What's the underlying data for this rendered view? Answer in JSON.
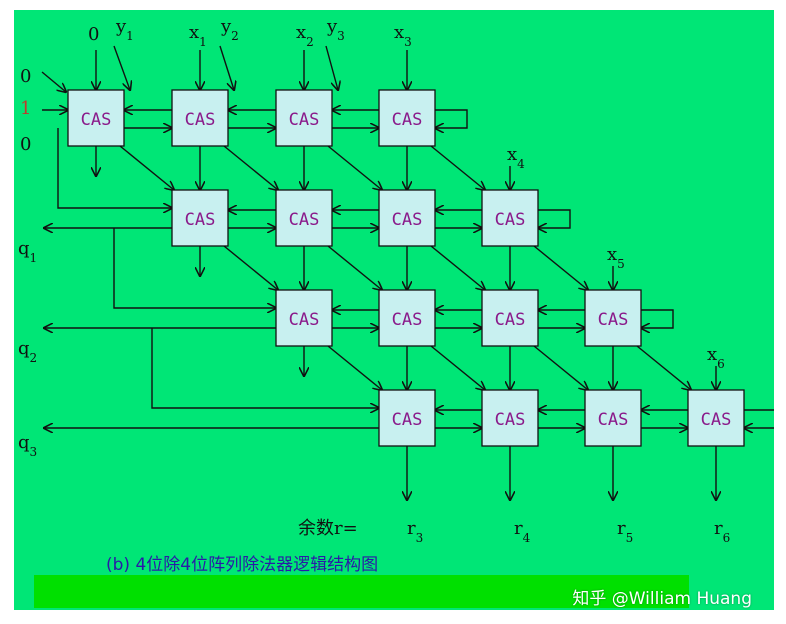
{
  "colors": {
    "background": "#00e676",
    "cell_fill": "#c8f0f0",
    "cell_text": "#8a1a8a",
    "line": "#111111",
    "highlight_label": "#c0392b",
    "bottom_band": "#00e000",
    "caption": "#2a1aa8"
  },
  "cells": {
    "label": "CAS"
  },
  "inputs": {
    "top": [
      "0",
      "y",
      "x",
      "y",
      "x",
      "y",
      "x"
    ],
    "top_subs": [
      "",
      "1",
      "1",
      "2",
      "2",
      "3",
      "3"
    ],
    "left": [
      "0",
      "1",
      "0"
    ],
    "x4": "x",
    "x4_sub": "4",
    "x5": "x",
    "x5_sub": "5",
    "x6": "x",
    "x6_sub": "6"
  },
  "outputs": {
    "q": [
      "q",
      "q",
      "q"
    ],
    "q_subs": [
      "1",
      "2",
      "3"
    ],
    "remainder_label": "余数r=",
    "r": [
      "r",
      "r",
      "r",
      "r"
    ],
    "r_subs": [
      "3",
      "4",
      "5",
      "6"
    ]
  },
  "caption": "(b) 4位除4位阵列除法器逻辑结构图",
  "watermark": "知乎 @William Huang"
}
